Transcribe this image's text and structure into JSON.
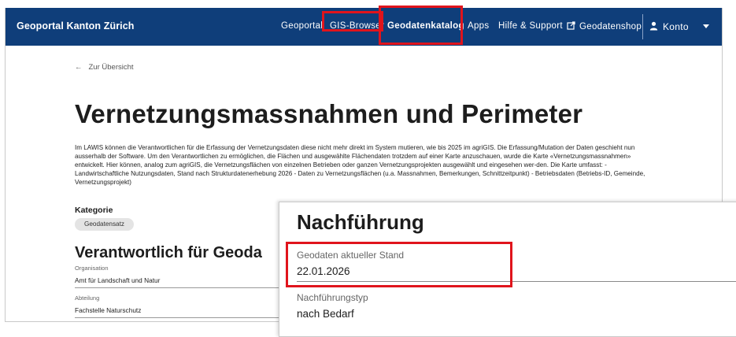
{
  "header": {
    "brand": "Geoportal Kanton Zürich",
    "nav": [
      "Geoportal",
      "GIS-Browser",
      "Geodatenkatalog",
      "Apps",
      "Hilfe & Support",
      "Geodatenshop",
      "Konto"
    ],
    "colors": {
      "navbar": "#0f3e7a",
      "highlight": "#e0141c"
    }
  },
  "back_link": "Zur Übersicht",
  "page": {
    "title": "Vernetzungsmassnahmen und Perimeter",
    "description": "Im LAWIS können die Verantwortlichen für die Erfassung der Vernetzungsdaten diese nicht mehr direkt im System mutieren, wie bis 2025 im agriGIS. Die Erfassung/Mutation der Daten geschieht nun ausserhalb der Software. Um den Verantwortlichen zu ermöglichen, die Flächen und ausgewählte Flächendaten trotzdem auf einer Karte anzuschauen, wurde die Karte «Vernetzungsmassnahmen» entwickelt. Hier können, analog zum agriGIS, die Vernetzungsflächen von einzelnen Betrieben oder ganzen Vernetzungsprojekten ausgewählt und eingesehen wer-den. Die Karte umfasst: - Landwirtschaftliche Nutzungsdaten, Stand nach Strukturdatenerhebung 2026 - Daten zu Vernetzungsflächen (u.a. Massnahmen, Bemerkungen, Schnittzeitpunkt) - Betriebsdaten (Betriebs-ID, Gemeinde, Vernetzungsprojekt)",
    "category_label": "Kategorie",
    "category_value": "Geodatensatz",
    "responsible_heading": "Verantwortlich für Geoda",
    "fields": [
      {
        "label": "Organisation",
        "value": "Amt für Landschaft und Natur"
      },
      {
        "label": "Abteilung",
        "value": "Fachstelle Naturschutz"
      }
    ]
  },
  "zoom": {
    "heading": "Nachführung",
    "fields": [
      {
        "label": "Geodaten aktueller Stand",
        "value": "22.01.2026"
      },
      {
        "label": "Nachführungstyp",
        "value": "nach Bedarf"
      }
    ]
  }
}
